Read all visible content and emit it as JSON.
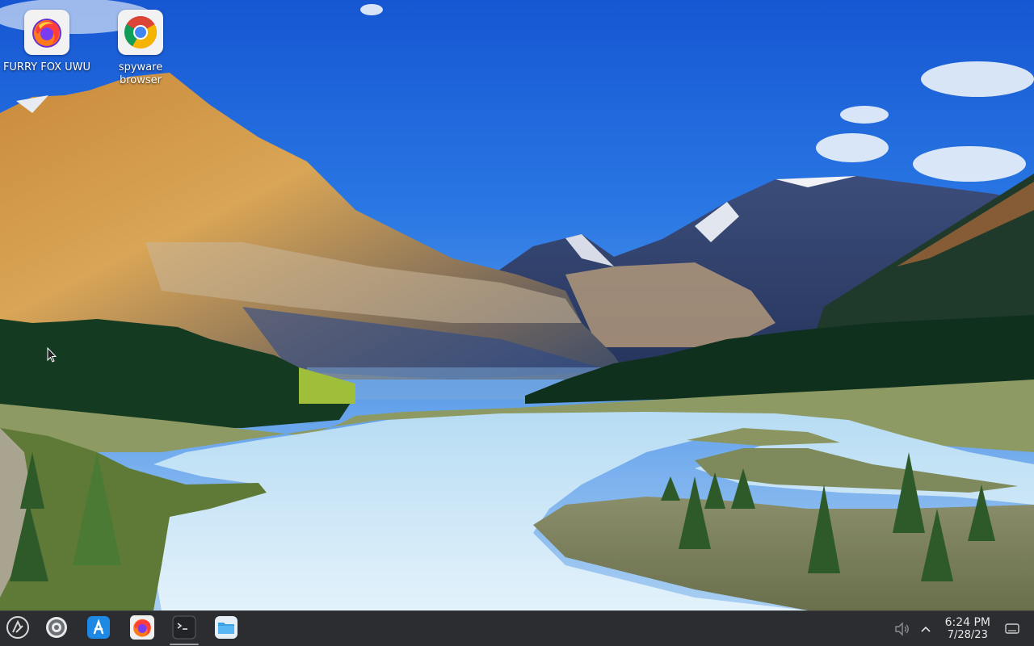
{
  "desktop": {
    "icons": [
      {
        "label": "FURRY FOX UWU",
        "icon": "firefox-icon"
      },
      {
        "label": "spyware browser",
        "icon": "chrome-icon"
      }
    ]
  },
  "taskbar": {
    "launcher": {
      "icon": "app-launcher-icon"
    },
    "pinned": [
      {
        "name": "system-settings",
        "icon": "settings-gear-icon"
      },
      {
        "name": "app-store",
        "icon": "app-store-icon"
      },
      {
        "name": "firefox",
        "icon": "firefox-icon"
      },
      {
        "name": "terminal",
        "icon": "terminal-icon",
        "active": true
      },
      {
        "name": "files",
        "icon": "folder-icon"
      }
    ],
    "tray": {
      "volume_icon": "volume-muted-icon",
      "expand_icon": "chevron-up-icon",
      "time": "6:24 PM",
      "date": "7/28/23",
      "show_desktop_icon": "show-desktop-icon"
    }
  },
  "colors": {
    "taskbar_bg": "#2b2d31",
    "sky_top": "#1d5fd6",
    "sky_bottom": "#7fb4ee",
    "water": "#cfe8f7"
  }
}
